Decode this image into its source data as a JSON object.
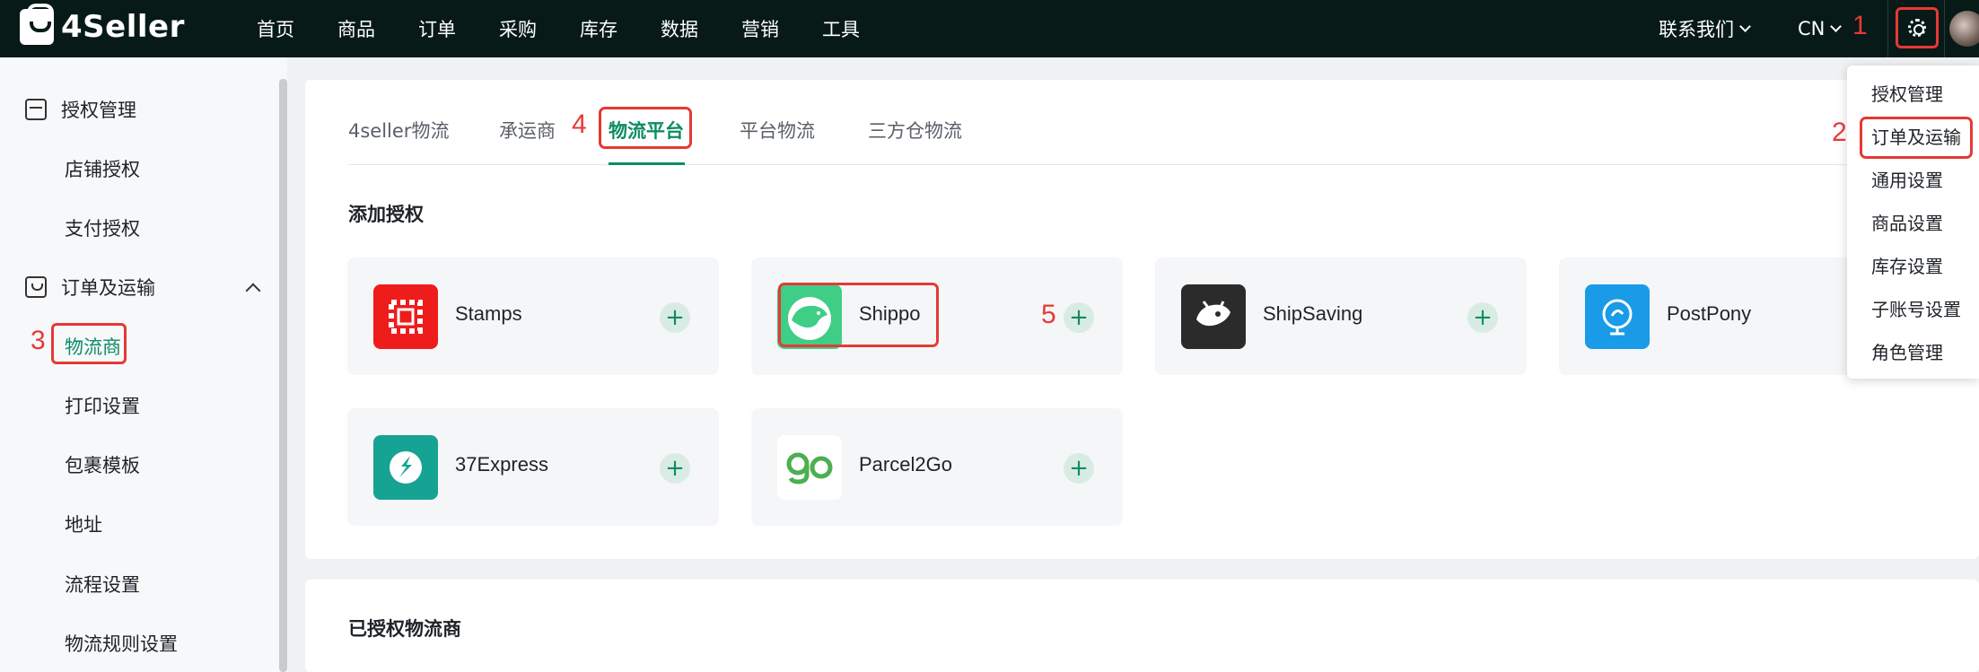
{
  "brand": {
    "name": "4Seller"
  },
  "topnav": {
    "items": [
      "首页",
      "商品",
      "订单",
      "采购",
      "库存",
      "数据",
      "营销",
      "工具"
    ],
    "contact": "联系我们",
    "lang": "CN"
  },
  "annotations": [
    "1",
    "2",
    "3",
    "4",
    "5"
  ],
  "sidebar": {
    "groups": [
      {
        "label": "授权管理",
        "items": [
          "店铺授权",
          "支付授权"
        ]
      },
      {
        "label": "订单及运输",
        "items": [
          "物流商",
          "打印设置",
          "包裹模板",
          "地址",
          "流程设置",
          "物流规则设置"
        ]
      }
    ],
    "active_item": "物流商"
  },
  "tabs": [
    "4seller物流",
    "承运商",
    "物流平台",
    "平台物流",
    "三方仓物流"
  ],
  "active_tab": "物流平台",
  "sections": {
    "add_auth": "添加授权",
    "authorized": "已授权物流商"
  },
  "platforms": [
    {
      "name": "Stamps",
      "logo": "stamps-logo",
      "color": "#ef1c1c"
    },
    {
      "name": "Shippo",
      "logo": "shippo-logo",
      "color": "#3fce86"
    },
    {
      "name": "ShipSaving",
      "logo": "shipsaving-logo",
      "color": "#2b2b2b"
    },
    {
      "name": "PostPony",
      "logo": "postpony-logo",
      "color": "#1a9be8"
    },
    {
      "name": "37Express",
      "logo": "37express-logo",
      "color": "#17a394"
    },
    {
      "name": "Parcel2Go",
      "logo": "parcel2go-logo",
      "color": "#4caf50"
    }
  ],
  "add_symbol": "+",
  "settings_menu": [
    "授权管理",
    "订单及运输",
    "通用设置",
    "商品设置",
    "库存设置",
    "子账号设置",
    "角色管理"
  ],
  "colors": {
    "topbar": "#071a17",
    "accent": "#0e8c63",
    "annotation": "#e53935"
  }
}
